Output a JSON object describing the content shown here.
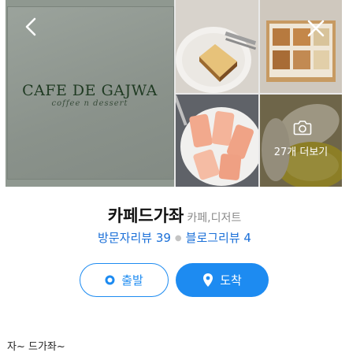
{
  "gallery": {
    "logo_main": "CAFE DE GAJWA",
    "logo_sub": "coffee n dessert",
    "more_photos_label": "27개 더보기"
  },
  "place": {
    "name": "카페드가좌",
    "category": "카페,디저트"
  },
  "reviews": {
    "visitor": "방문자리뷰 39",
    "blog": "블로그리뷰 4"
  },
  "actions": {
    "start_label": "출발",
    "arrive_label": "도착"
  },
  "caption": "자~ 드가좌~",
  "colors": {
    "accent": "#1d8bf1",
    "link": "#1a6fd8"
  }
}
